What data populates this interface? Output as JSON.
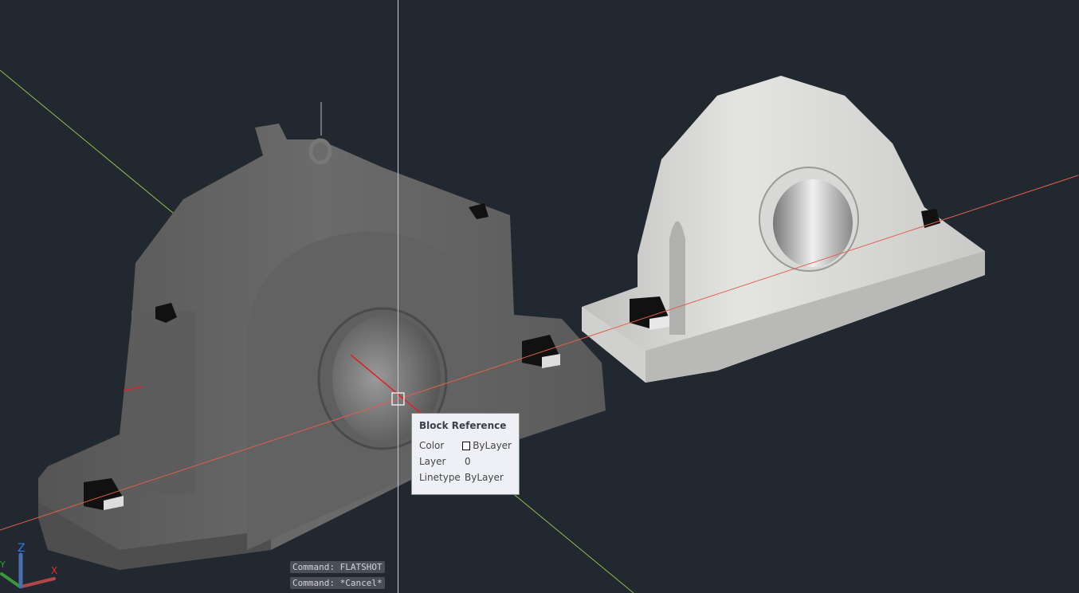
{
  "tooltip": {
    "title": "Block Reference",
    "rows": [
      {
        "label": "Color",
        "value": "ByLayer"
      },
      {
        "label": "Layer",
        "value": "0"
      },
      {
        "label": "Linetype",
        "value": "ByLayer"
      }
    ]
  },
  "command_history": [
    "Command: FLATSHOT",
    "Command: *Cancel*"
  ],
  "ucs": {
    "x": "X",
    "y": "Y",
    "z": "Z"
  },
  "colors": {
    "background": "#212830",
    "x_axis": "#e0604a",
    "y_axis": "#8fc04a",
    "z_axis": "#2f7cf0"
  }
}
